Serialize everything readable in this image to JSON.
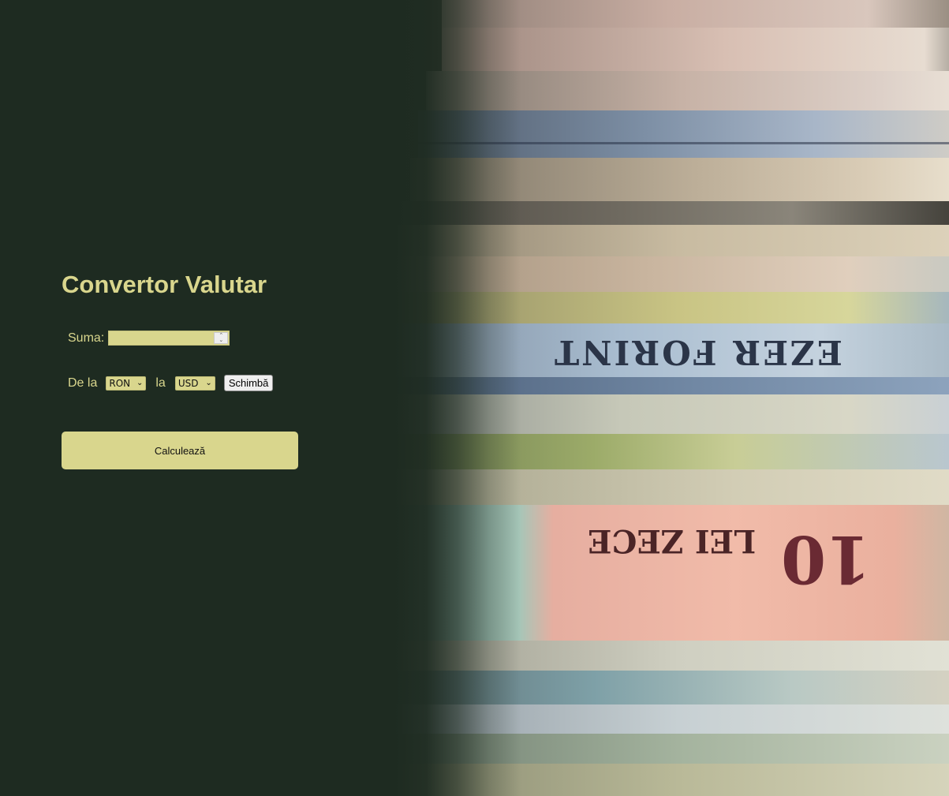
{
  "app": {
    "title": "Convertor Valutar"
  },
  "form": {
    "amount_label": "Suma:",
    "amount_value": "",
    "from_label": "De la",
    "from_currency": "RON",
    "to_label": "la",
    "to_currency": "USD",
    "swap_label": "Schimbă",
    "calculate_label": "Calculează"
  },
  "background": {
    "description_icon": "banknotes-photo",
    "forint_text": "EZER FORINT",
    "lei_text": "LEI ZECE",
    "lei_number": "10"
  },
  "colors": {
    "page_background": "#1e2b21",
    "accent": "#d9d68d"
  }
}
